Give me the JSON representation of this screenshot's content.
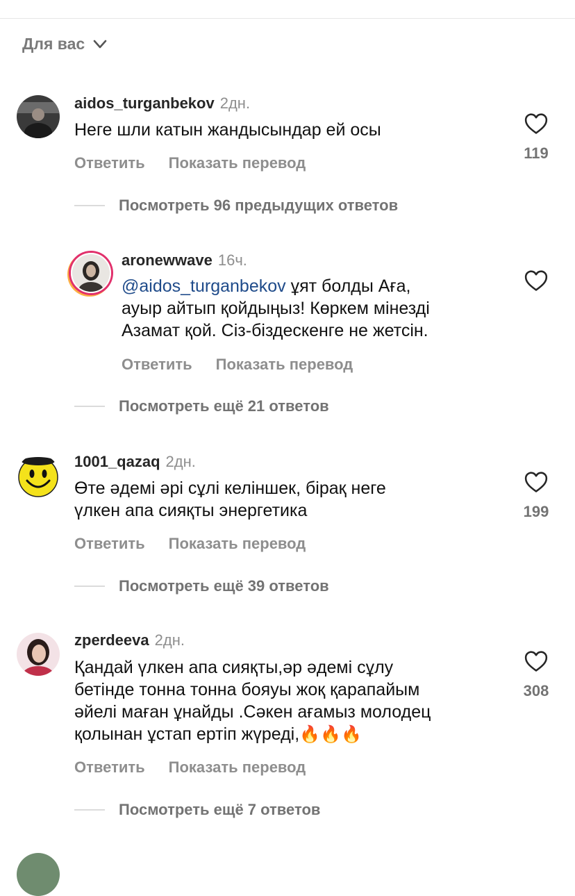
{
  "filter": {
    "label": "Для вас"
  },
  "comments": [
    {
      "username": "aidos_turganbekov",
      "time": "2дн.",
      "text": "Неге шли катын жандысындар ей осы",
      "reply_label": "Ответить",
      "translate_label": "Показать перевод",
      "likes": "119",
      "more_replies": "Посмотреть 96 предыдущих ответов"
    },
    {
      "username": "aronewwave",
      "time": "16ч.",
      "mention": "@aidos_turganbekov",
      "text_lines": [
        "ұят болды Аға,",
        "ауыр айтып қойдыңыз! Көркем мінезді",
        "Азамат қой. Сіз-біздескенге не жетсін."
      ],
      "reply_label": "Ответить",
      "translate_label": "Показать перевод",
      "more_replies": "Посмотреть ещё 21 ответов"
    },
    {
      "username": "1001_qazaq",
      "time": "2дн.",
      "text_lines": [
        "Өте әдемі әрі сұлі келіншек, бірақ неге",
        "үлкен апа сияқты энергетика"
      ],
      "reply_label": "Ответить",
      "translate_label": "Показать перевод",
      "likes": "199",
      "more_replies": "Посмотреть ещё 39 ответов"
    },
    {
      "username": "zperdeeva",
      "time": "2дн.",
      "text_lines": [
        "Қандай үлкен апа сияқты,әр әдемі сұлу",
        "бетінде тонна тонна бояуы жоқ қарапайым",
        "әйелі маған ұнайды .Сәкен ағамыз молодец",
        "қолынан ұстап ертіп жүреді,"
      ],
      "emoji_trail": "🔥🔥🔥",
      "reply_label": "Ответить",
      "translate_label": "Показать перевод",
      "likes": "308",
      "more_replies": "Посмотреть ещё 7 ответов"
    }
  ],
  "colors": {
    "mention": "#1f4b8a",
    "muted": "#8e8e8e",
    "story_ring": "#e1306c"
  }
}
